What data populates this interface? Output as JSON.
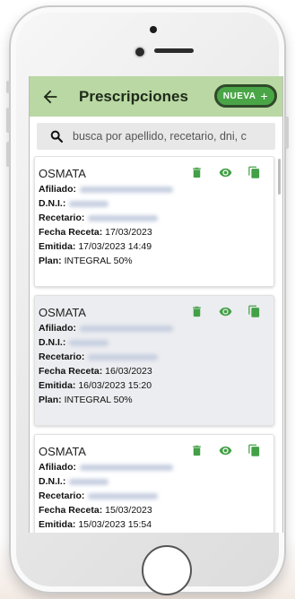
{
  "appbar": {
    "title": "Prescripciones",
    "new_button_label": "NUEVA",
    "new_button_symbol": "+"
  },
  "search": {
    "placeholder": "busca por apellido, recetario, dni, c",
    "value": ""
  },
  "labels": {
    "afiliado": "Afiliado:",
    "dni": "D.N.I.:",
    "recetario": "Recetario:",
    "fecha_receta": "Fecha Receta:",
    "emitida": "Emitida:",
    "plan": "Plan:"
  },
  "prescriptions": [
    {
      "obra_social": "OSMATA",
      "fecha_receta": "17/03/2023",
      "emitida": "17/03/2023 14:49",
      "plan": "INTEGRAL 50%"
    },
    {
      "obra_social": "OSMATA",
      "fecha_receta": "16/03/2023",
      "emitida": "16/03/2023 15:20",
      "plan": "INTEGRAL 50%"
    },
    {
      "obra_social": "OSMATA",
      "fecha_receta": "15/03/2023",
      "emitida": "15/03/2023 15:54",
      "plan": ""
    }
  ],
  "colors": {
    "appbar": "#b9d8a3",
    "accent": "#4aa547",
    "icon_green": "#43a047"
  },
  "icons": {
    "back": "arrow-left-icon",
    "search": "search-icon",
    "delete": "trash-icon",
    "view": "eye-icon",
    "copy": "copy-icon"
  }
}
